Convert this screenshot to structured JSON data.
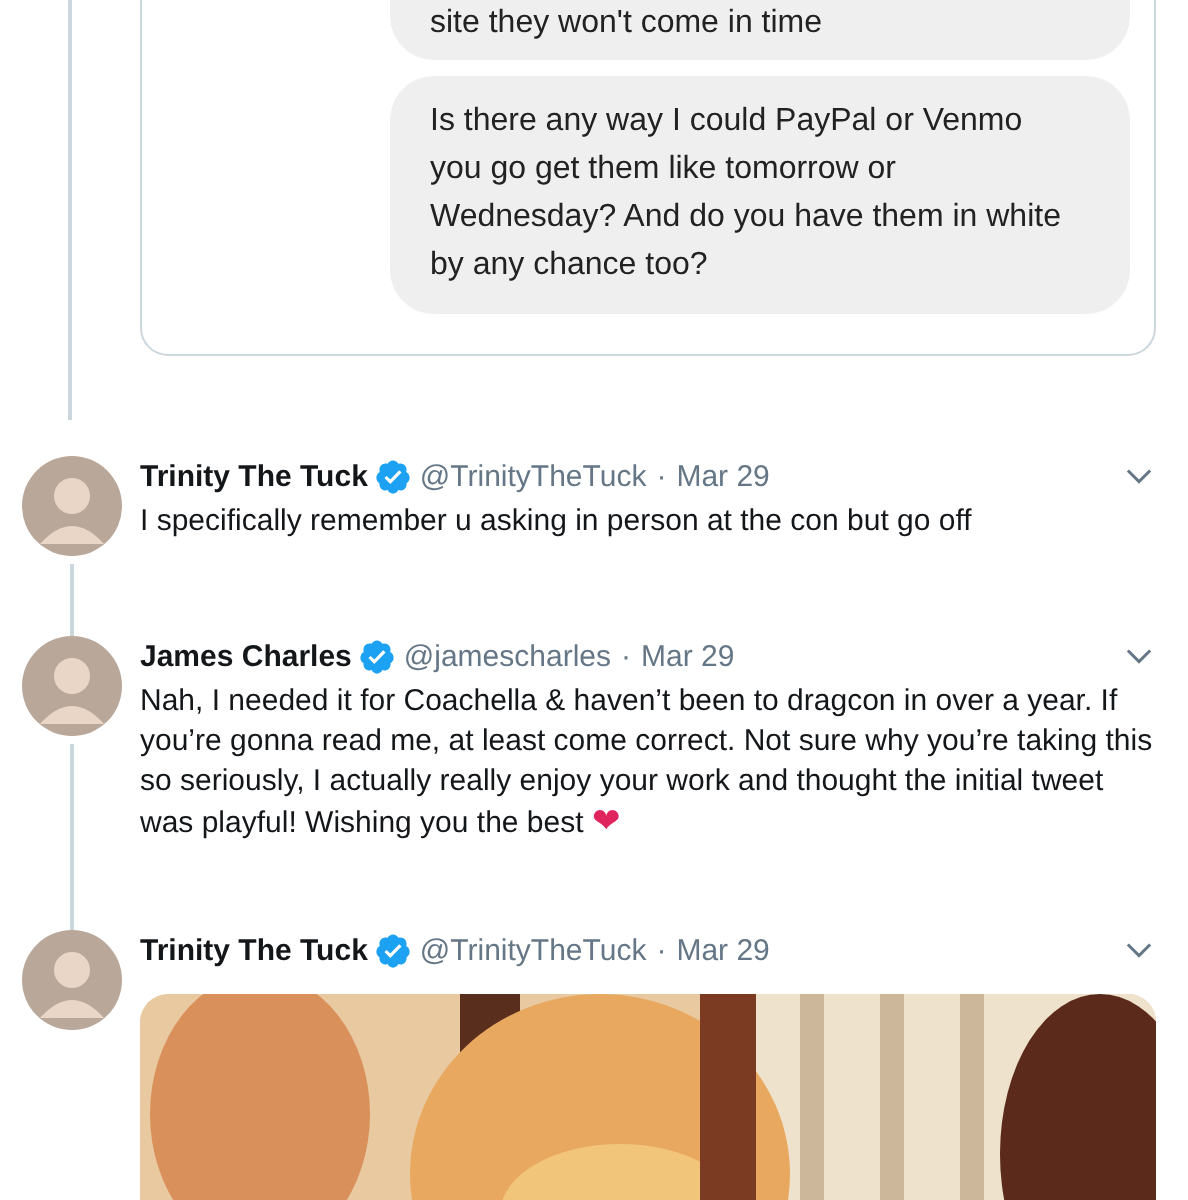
{
  "quoted_card": {
    "messages": [
      {
        "text": "site they won't come in time"
      },
      {
        "text": "Is there any way I could PayPal or Venmo you go get them like tomorrow or Wednesday? And do you have them in white by any chance too?"
      }
    ]
  },
  "tweets": [
    {
      "name": "Trinity The Tuck",
      "verified": true,
      "handle": "@TrinityTheTuck",
      "separator": "·",
      "date": "Mar 29",
      "text": "I specifically remember u asking in person at the con but go off",
      "thread_line": true
    },
    {
      "name": "James Charles",
      "verified": true,
      "handle": "@jamescharles",
      "separator": "·",
      "date": "Mar 29",
      "text": "Nah, I needed it for Coachella & haven’t been to dragcon in over a year. If you’re gonna read me, at least come correct. Not sure why you’re taking this so seriously, I actually really enjoy your work and thought the initial tweet was playful! Wishing you the best",
      "emoji": "❤",
      "thread_line": true
    },
    {
      "name": "Trinity The Tuck",
      "verified": true,
      "handle": "@TrinityTheTuck",
      "separator": "·",
      "date": "Mar 29",
      "thread_line": false
    }
  ]
}
